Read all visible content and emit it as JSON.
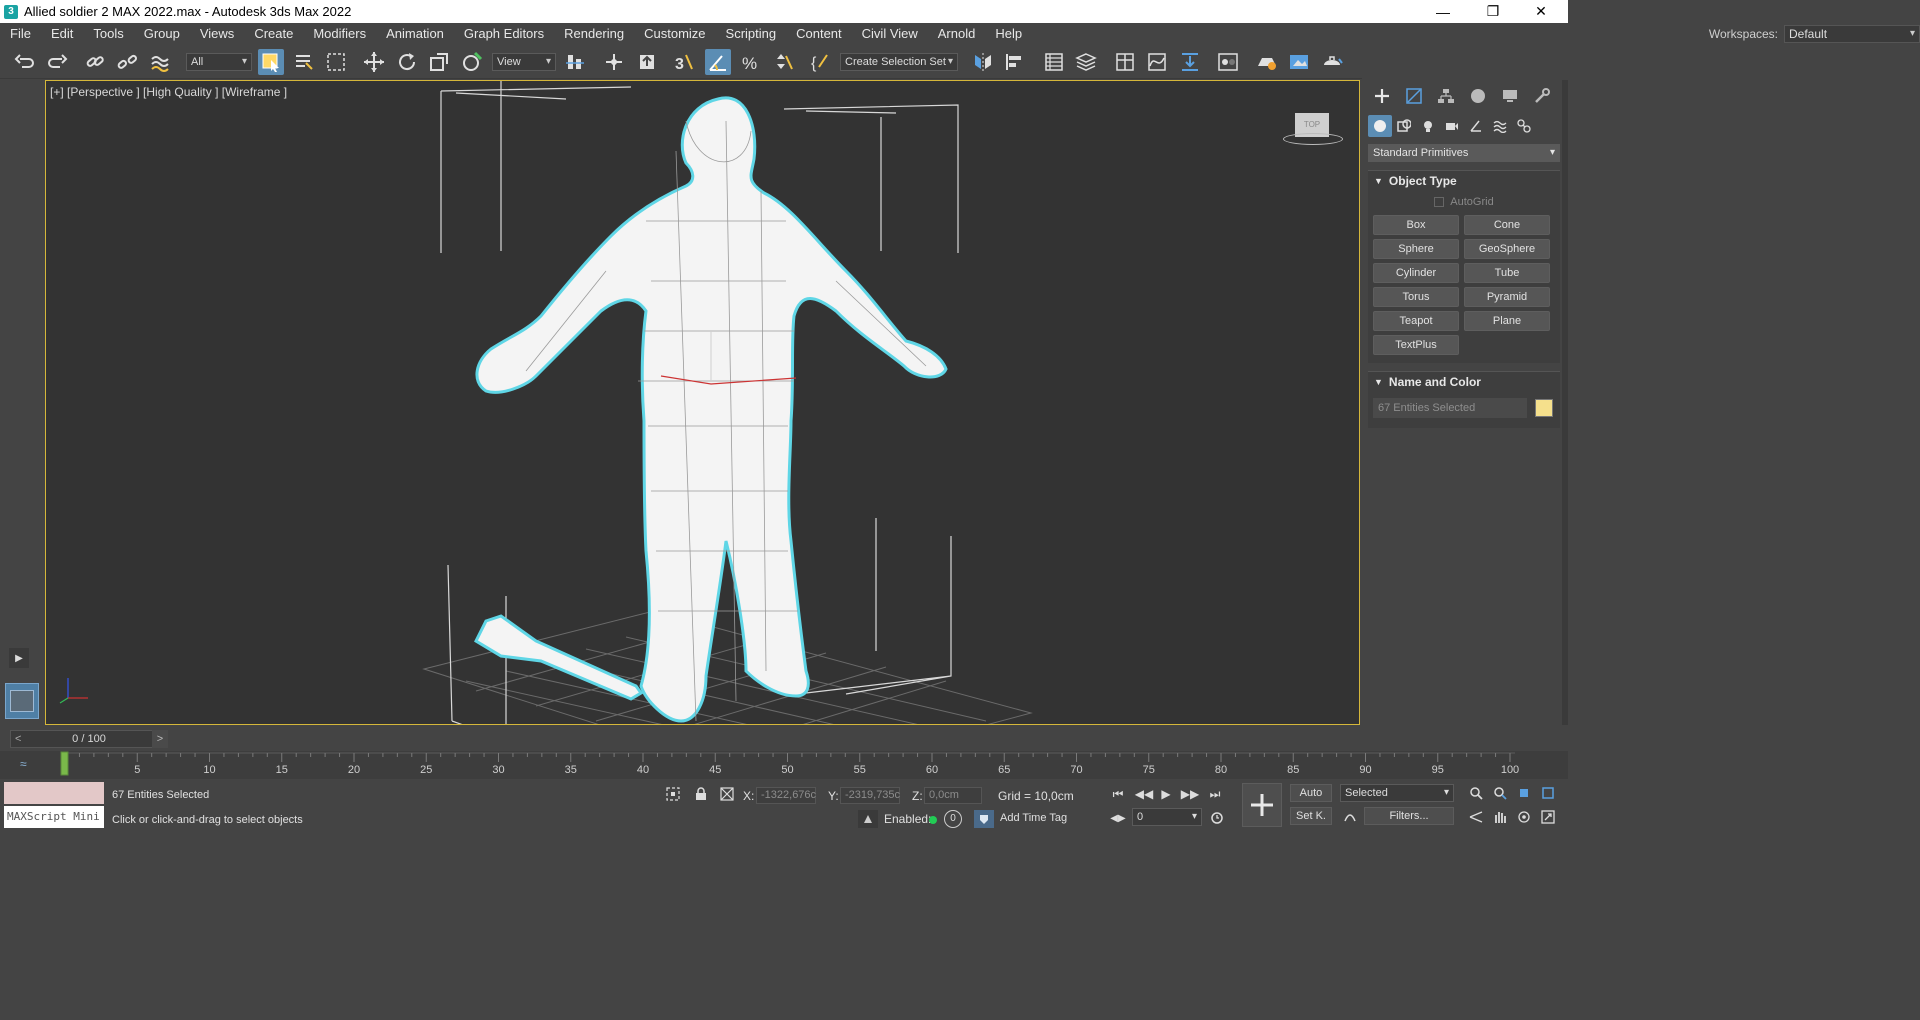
{
  "window": {
    "title": "Allied soldier 2 MAX 2022.max - Autodesk 3ds Max 2022",
    "app_icon": "3",
    "controls": {
      "minimize": "—",
      "restore": "❐",
      "close": "✕"
    }
  },
  "menu": [
    "File",
    "Edit",
    "Tools",
    "Group",
    "Views",
    "Create",
    "Modifiers",
    "Animation",
    "Graph Editors",
    "Rendering",
    "Customize",
    "Scripting",
    "Content",
    "Civil View",
    "Arnold",
    "Help"
  ],
  "workspace": {
    "label": "Workspaces:",
    "value": "Default"
  },
  "toolbar": {
    "selection_filter": "All",
    "reference_coord": "View",
    "selection_set": "Create Selection Set"
  },
  "viewport": {
    "label": "[+] [Perspective ] [High Quality ] [Wireframe ]",
    "viewcube_label": "TOP"
  },
  "command_panel": {
    "category": "Standard Primitives",
    "object_type": {
      "title": "Object Type",
      "autogrid": "AutoGrid",
      "buttons": [
        "Box",
        "Cone",
        "Sphere",
        "GeoSphere",
        "Cylinder",
        "Tube",
        "Torus",
        "Pyramid",
        "Teapot",
        "Plane",
        "TextPlus"
      ]
    },
    "name_and_color": {
      "title": "Name and Color",
      "name_value": "67 Entities Selected",
      "color": "#f5e08c"
    }
  },
  "timeline": {
    "frame_display": "0 / 100",
    "prev": "<",
    "next": ">",
    "ruler": [
      "5",
      "10",
      "15",
      "20",
      "25",
      "30",
      "35",
      "40",
      "45",
      "50",
      "55",
      "60",
      "65",
      "70",
      "75",
      "80",
      "85",
      "90",
      "95",
      "100"
    ]
  },
  "status": {
    "maxscript_label": "MAXScript Mini",
    "selection_text": "67 Entities Selected",
    "prompt_text": "Click or click-and-drag to select objects",
    "x_label": "X:",
    "x_value": "-1322,676c",
    "y_label": "Y:",
    "y_value": "-2319,735c",
    "z_label": "Z:",
    "z_value": "0,0cm",
    "grid": "Grid = 10,0cm",
    "enabled_label": "Enabled:",
    "enabled_count": "0",
    "add_time_tag": "Add Time Tag",
    "auto_key": "Auto",
    "set_key": "Set K.",
    "key_filter": "Selected",
    "filters": "Filters...",
    "frame_value": "0"
  }
}
